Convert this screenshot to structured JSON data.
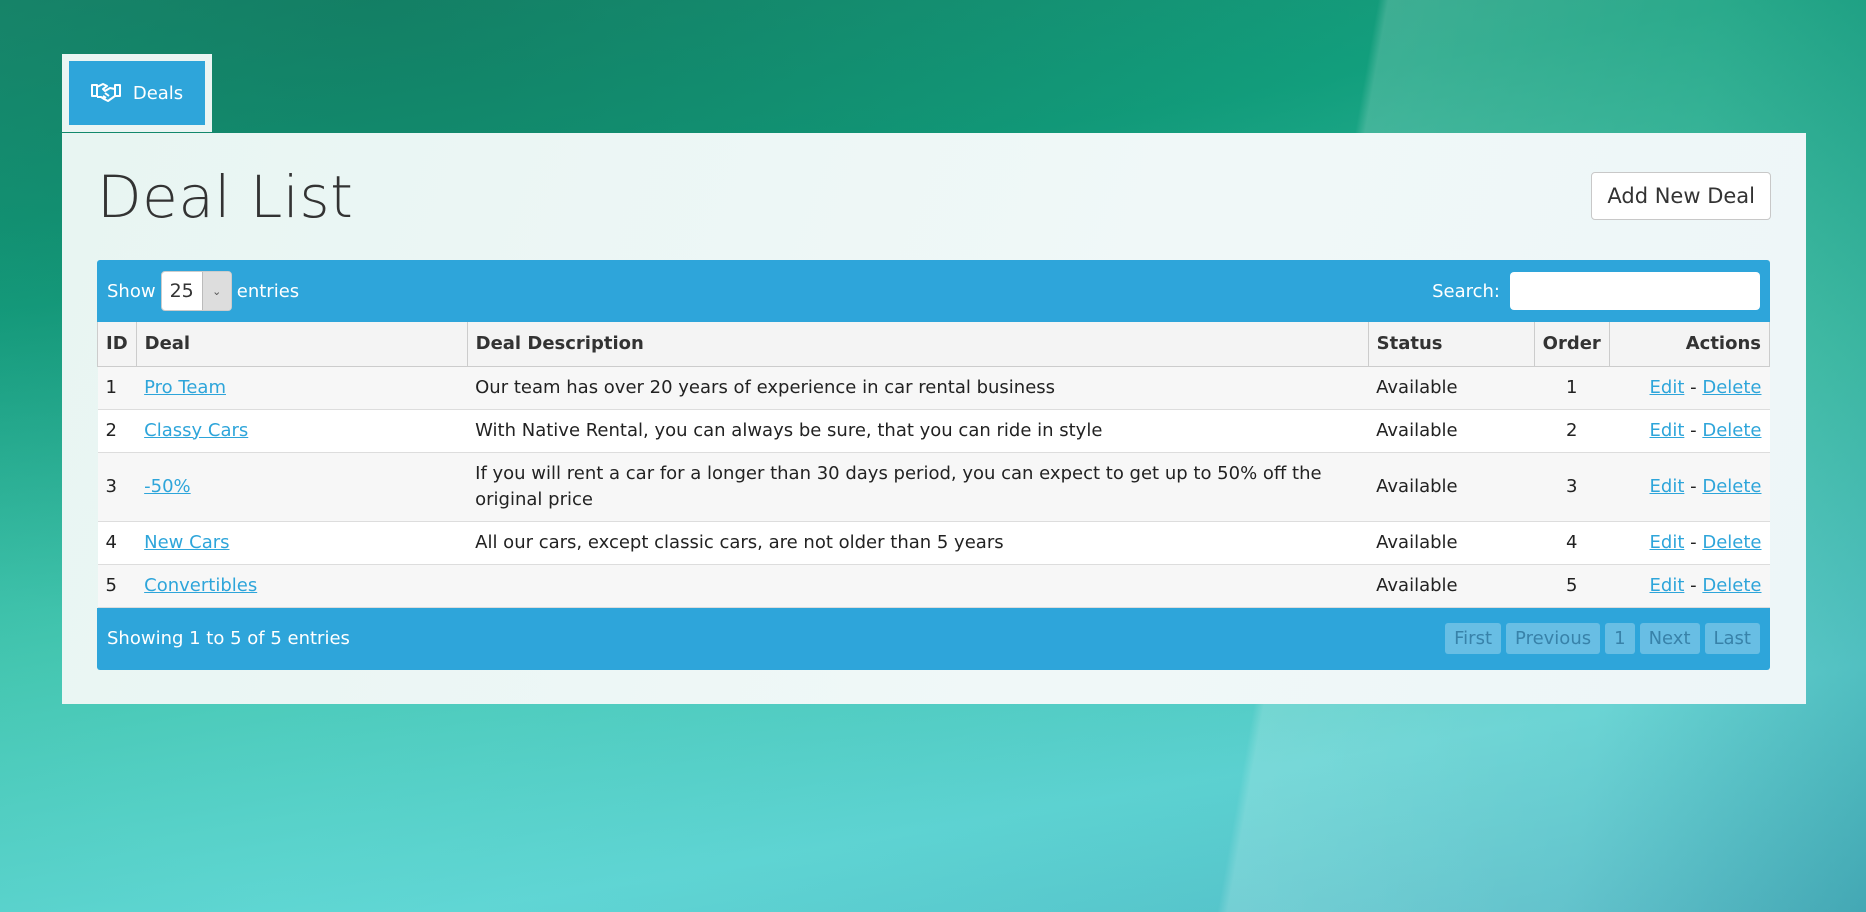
{
  "nav": {
    "tab_label": "Deals",
    "tab_icon": "handshake-icon"
  },
  "page": {
    "title": "Deal List",
    "add_button": "Add New Deal"
  },
  "table_controls": {
    "show_label": "Show",
    "page_length": "25",
    "entries_label": "entries",
    "search_label": "Search:",
    "search_value": ""
  },
  "table": {
    "columns": [
      "ID",
      "Deal",
      "Deal Description",
      "Status",
      "Order",
      "Actions"
    ],
    "rows": [
      {
        "id": "1",
        "deal": "Pro Team",
        "description": "Our team has over 20 years of experience in car rental business",
        "status": "Available",
        "order": "1",
        "edit": "Edit",
        "sep": "-",
        "delete": "Delete"
      },
      {
        "id": "2",
        "deal": "Classy Cars",
        "description": "With Native Rental, you can always be sure, that you can ride in style",
        "status": "Available",
        "order": "2",
        "edit": "Edit",
        "sep": "-",
        "delete": "Delete"
      },
      {
        "id": "3",
        "deal": "-50%",
        "description": "If you will rent a car for a longer than 30 days period, you can expect to get up to 50% off the original price",
        "status": "Available",
        "order": "3",
        "edit": "Edit",
        "sep": "-",
        "delete": "Delete"
      },
      {
        "id": "4",
        "deal": "New Cars",
        "description": "All our cars, except classic cars, are not older than 5 years",
        "status": "Available",
        "order": "4",
        "edit": "Edit",
        "sep": "-",
        "delete": "Delete"
      },
      {
        "id": "5",
        "deal": "Convertibles",
        "description": "",
        "status": "Available",
        "order": "5",
        "edit": "Edit",
        "sep": "-",
        "delete": "Delete"
      }
    ]
  },
  "footer": {
    "info": "Showing 1 to 5 of 5 entries",
    "pagination": [
      "First",
      "Previous",
      "1",
      "Next",
      "Last"
    ]
  },
  "colors": {
    "accent": "#2ea5da",
    "link": "#2ea5da"
  }
}
